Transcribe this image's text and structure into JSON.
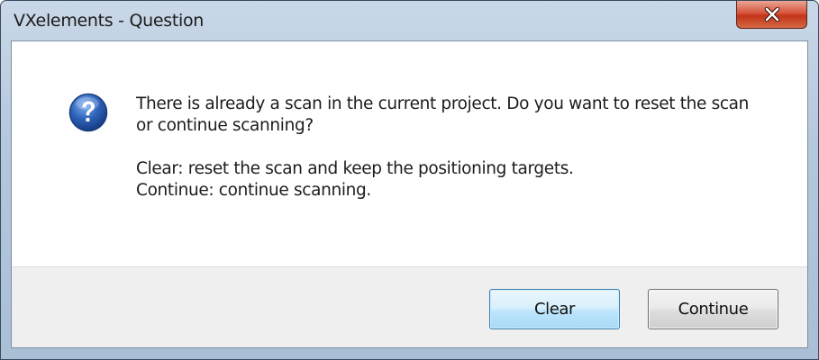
{
  "window": {
    "title": "VXelements - Question",
    "close_icon": "close-icon"
  },
  "dialog": {
    "icon": "question-icon",
    "message_line1": "There is already a scan in the current project. Do you want to reset the scan",
    "message_line2": "or continue scanning?",
    "detail_clear": "Clear: reset the scan and keep the positioning targets.",
    "detail_continue": "Continue: continue scanning."
  },
  "buttons": {
    "clear_label": "Clear",
    "continue_label": "Continue"
  },
  "colors": {
    "titlebar": "#b4c8dc",
    "close_button": "#c2341a",
    "default_button_border": "#3c7fb1",
    "footer": "#efefef",
    "question_icon": "#2a5db0"
  }
}
